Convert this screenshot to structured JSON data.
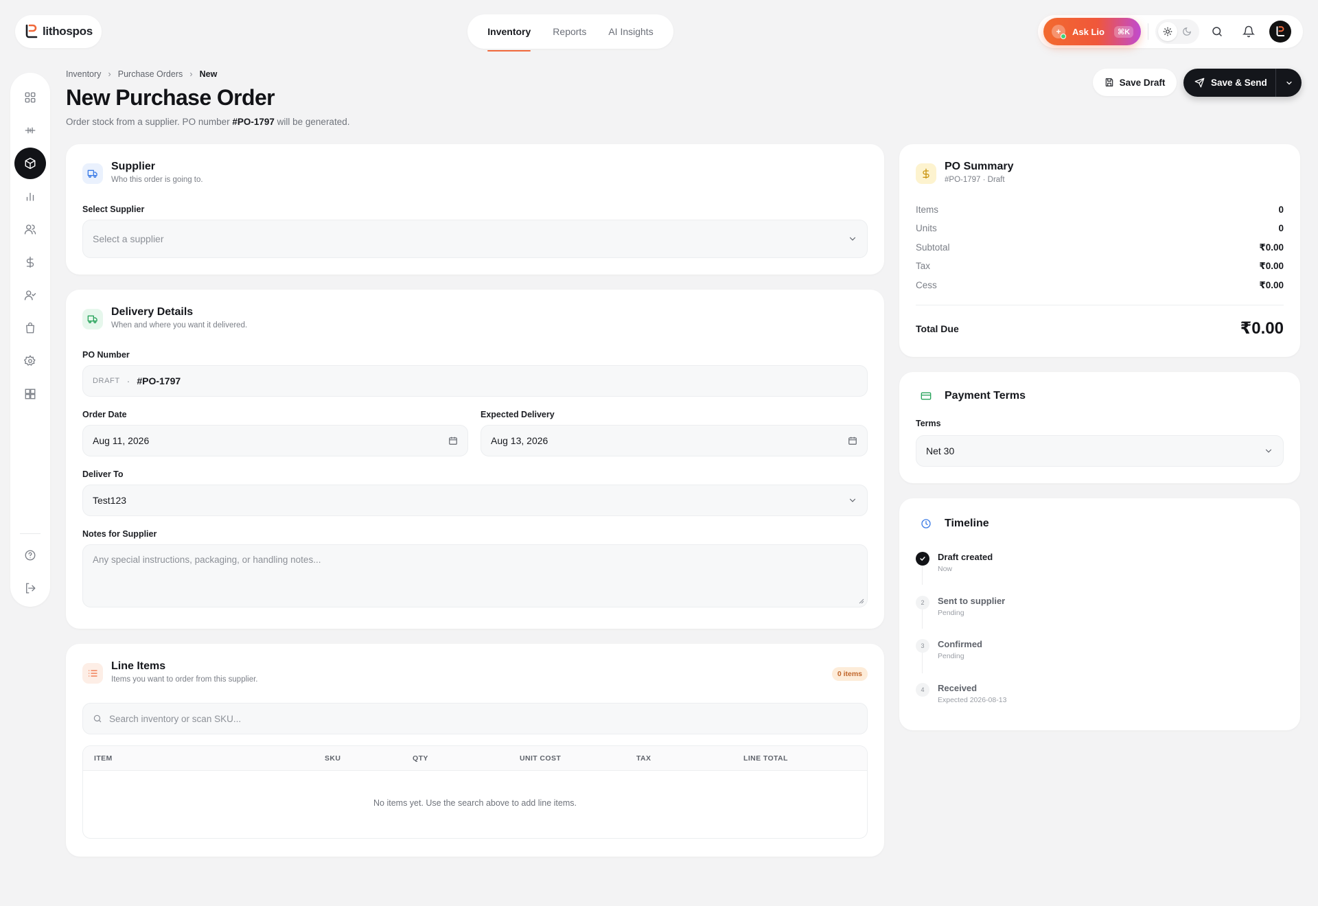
{
  "brand": {
    "name": "lithospos"
  },
  "nav": {
    "tabs": [
      "Inventory",
      "Reports",
      "AI Insights"
    ]
  },
  "topbar": {
    "ask_label": "Ask Lio",
    "ask_shortcut": "⌘K"
  },
  "breadcrumb": [
    "Inventory",
    "Purchase Orders",
    "New"
  ],
  "page": {
    "title": "New Purchase Order",
    "subtitle_pre": "Order stock from a supplier. PO number ",
    "subtitle_po": "#PO-1797",
    "subtitle_post": " will be generated."
  },
  "actions": {
    "save_draft": "Save Draft",
    "save_send": "Save & Send"
  },
  "supplier": {
    "title": "Supplier",
    "desc": "Who this order is going to.",
    "label": "Select Supplier",
    "placeholder": "Select a supplier"
  },
  "delivery": {
    "title": "Delivery Details",
    "desc": "When and where you want it delivered.",
    "po_label": "PO Number",
    "po_status": "DRAFT",
    "po_dot": "·",
    "po_number": "#PO-1797",
    "order_date_label": "Order Date",
    "order_date": "Aug 11, 2026",
    "expected_label": "Expected Delivery",
    "expected_date": "Aug 13, 2026",
    "deliver_to_label": "Deliver To",
    "deliver_to": "Test123",
    "notes_label": "Notes for Supplier",
    "notes_placeholder": "Any special instructions, packaging, or handling notes..."
  },
  "line_items": {
    "title": "Line Items",
    "desc": "Items you want to order from this supplier.",
    "badge": "0 items",
    "search_placeholder": "Search inventory or scan SKU...",
    "columns": [
      "ITEM",
      "SKU",
      "QTY",
      "UNIT COST",
      "TAX",
      "LINE TOTAL"
    ],
    "empty": "No items yet. Use the search above to add line items."
  },
  "summary": {
    "title": "PO Summary",
    "subtitle": "#PO-1797 · Draft",
    "rows": [
      {
        "k": "Items",
        "v": "0"
      },
      {
        "k": "Units",
        "v": "0"
      },
      {
        "k": "Subtotal",
        "v": "₹0.00"
      },
      {
        "k": "Tax",
        "v": "₹0.00"
      },
      {
        "k": "Cess",
        "v": "₹0.00"
      }
    ],
    "total_label": "Total Due",
    "total_value": "₹0.00"
  },
  "payment": {
    "title": "Payment Terms",
    "label": "Terms",
    "value": "Net 30"
  },
  "timeline": {
    "title": "Timeline",
    "items": [
      {
        "num": "",
        "title": "Draft created",
        "meta": "Now"
      },
      {
        "num": "2",
        "title": "Sent to supplier",
        "meta": "Pending"
      },
      {
        "num": "3",
        "title": "Confirmed",
        "meta": "Pending"
      },
      {
        "num": "4",
        "title": "Received",
        "meta": "Expected 2026-08-13"
      }
    ]
  },
  "colors": {
    "accent": "#f0683a",
    "dark": "#14161b",
    "background": "#f3f3f4"
  }
}
